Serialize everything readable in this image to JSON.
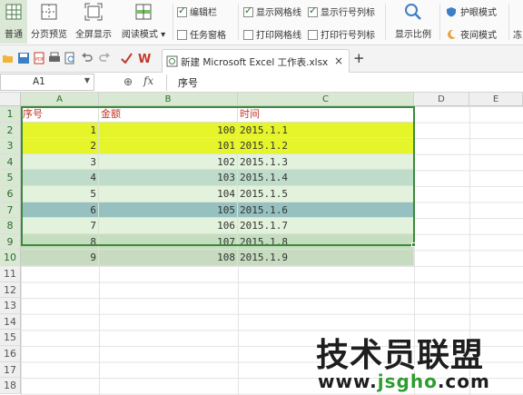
{
  "ribbon": {
    "buttons": [
      {
        "label": "普通",
        "icon": "normal-view-icon",
        "active": true
      },
      {
        "label": "分页预览",
        "icon": "page-break-preview-icon"
      },
      {
        "label": "全屏显示",
        "icon": "fullscreen-icon"
      },
      {
        "label": "阅读模式 ▾",
        "icon": "reading-mode-icon"
      }
    ],
    "checks": [
      {
        "label": "编辑栏",
        "checked": true
      },
      {
        "label": "任务窗格",
        "checked": false
      },
      {
        "label": "显示网格线",
        "checked": true
      },
      {
        "label": "打印网格线",
        "checked": false
      },
      {
        "label": "显示行号列标",
        "checked": true
      },
      {
        "label": "打印行号列标",
        "checked": false
      }
    ],
    "zoom_label": "显示比例",
    "eye_mode": "护眼模式",
    "night_mode": "夜间模式",
    "truncated": "冻"
  },
  "tab": {
    "title": "新建 Microsoft Excel 工作表.xlsx",
    "close": "×",
    "add": "+"
  },
  "formula_bar": {
    "cell_ref": "A1",
    "fx": "fx",
    "content": "序号"
  },
  "columns": [
    "A",
    "B",
    "C",
    "D",
    "E"
  ],
  "rows": [
    "1",
    "2",
    "3",
    "4",
    "5",
    "6",
    "7",
    "8",
    "9",
    "10",
    "11",
    "12",
    "13",
    "14",
    "15",
    "16",
    "17",
    "18"
  ],
  "sheet": {
    "header": [
      "序号",
      "金额",
      "时间"
    ],
    "data": [
      {
        "seq": "1",
        "amount": "100",
        "date": "2015.1.1"
      },
      {
        "seq": "2",
        "amount": "101",
        "date": "2015.1.2"
      },
      {
        "seq": "3",
        "amount": "102",
        "date": "2015.1.3"
      },
      {
        "seq": "4",
        "amount": "103",
        "date": "2015.1.4"
      },
      {
        "seq": "5",
        "amount": "104",
        "date": "2015.1.5"
      },
      {
        "seq": "6",
        "amount": "105",
        "date": "2015.1.6"
      },
      {
        "seq": "7",
        "amount": "106",
        "date": "2015.1.7"
      },
      {
        "seq": "8",
        "amount": "107",
        "date": "2015.1.8"
      },
      {
        "seq": "9",
        "amount": "108",
        "date": "2015.1.9"
      }
    ],
    "row_colors": [
      "#ffffff",
      "#e6f52a",
      "#e6f52a",
      "#e3f2dc",
      "#bfdccb",
      "#e3f2dc",
      "#96c1c0",
      "#e3f2dc",
      "#c6dec0",
      "#c6dbbf"
    ]
  },
  "watermark": {
    "main": "技术员联盟",
    "url_prefix": "www.",
    "url_mid": "jsgho",
    "url_suffix": ".com"
  },
  "colors": {
    "accent": "#3a8a3a",
    "header_text": "#c0392b"
  }
}
